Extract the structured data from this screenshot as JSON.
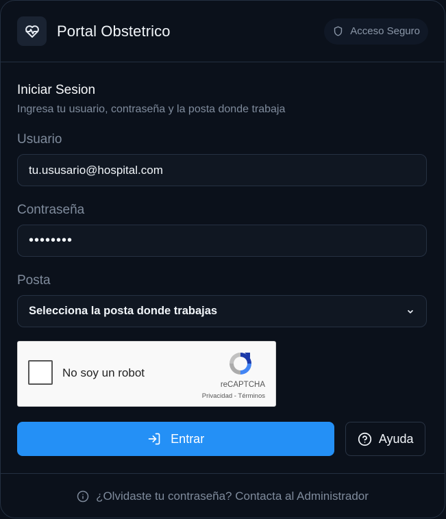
{
  "header": {
    "title": "Portal Obstetrico",
    "badge_label": "Acceso Seguro"
  },
  "form": {
    "title": "Iniciar Sesion",
    "subtitle": "Ingresa tu usuario, contraseña y la posta donde trabaja",
    "username": {
      "label": "Usuario",
      "value": "tu.ususario@hospital.com"
    },
    "password": {
      "label": "Contraseña",
      "masked_value": "••••••••"
    },
    "posta": {
      "label": "Posta",
      "selected": "Selecciona la posta donde trabajas"
    }
  },
  "captcha": {
    "label": "No soy un robot",
    "brand": "reCAPTCHA",
    "links": "Privacidad - Términos",
    "checked": false
  },
  "actions": {
    "submit_label": "Entrar",
    "help_label": "Ayuda"
  },
  "footer": {
    "text": "¿Olvidaste tu contraseña? Contacta al Administrador"
  },
  "colors": {
    "background": "#0b111b",
    "primary": "#2490f6",
    "border": "#243041",
    "muted_text": "#7f8b9c"
  },
  "icons": {
    "logo": "heart-pulse-icon",
    "badge": "shield-icon",
    "select": "chevron-down-icon",
    "submit": "log-in-icon",
    "help": "question-circle-icon",
    "footer": "info-icon"
  }
}
